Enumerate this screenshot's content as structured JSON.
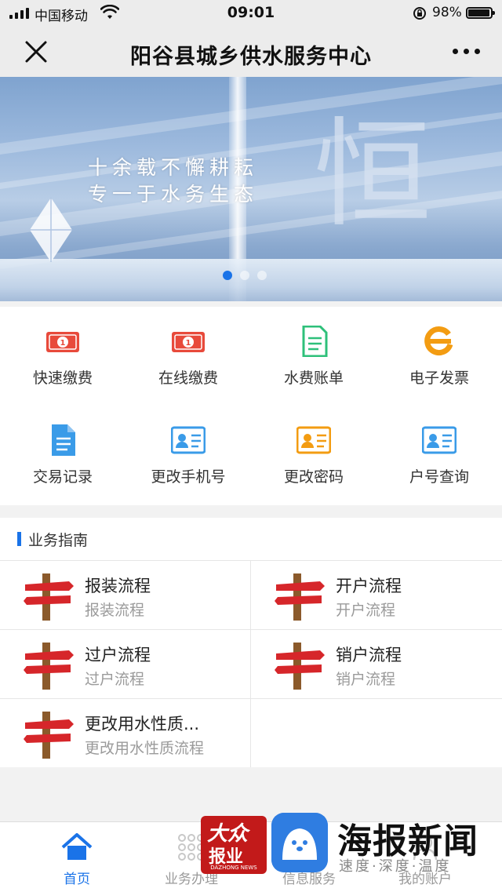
{
  "status_bar": {
    "carrier": "中国移动",
    "time": "09:01",
    "battery": "98%",
    "battery_level": 0.98
  },
  "nav": {
    "title": "阳谷县城乡供水服务中心"
  },
  "banner": {
    "line1": "十余载不懈耕耘",
    "line2": "专一于水务生态",
    "big_char": "恒",
    "slide_count": 3,
    "active_slide": 1
  },
  "services": [
    {
      "label": "快速缴费",
      "icon": "banknote-icon",
      "color": "#e84a3b"
    },
    {
      "label": "在线缴费",
      "icon": "banknote-icon",
      "color": "#e84a3b"
    },
    {
      "label": "水费账单",
      "icon": "document-icon",
      "color": "#2ec07a"
    },
    {
      "label": "电子发票",
      "icon": "browser-e-icon",
      "color": "#f39c12"
    },
    {
      "label": "交易记录",
      "icon": "file-icon",
      "color": "#3a9be8"
    },
    {
      "label": "更改手机号",
      "icon": "id-card-icon",
      "color": "#3a9be8"
    },
    {
      "label": "更改密码",
      "icon": "id-card-icon",
      "color": "#f39c12"
    },
    {
      "label": "户号查询",
      "icon": "id-card-icon",
      "color": "#3a9be8"
    }
  ],
  "guide": {
    "title": "业务指南",
    "items": [
      {
        "title": "报装流程",
        "subtitle": "报装流程"
      },
      {
        "title": "开户流程",
        "subtitle": "开户流程"
      },
      {
        "title": "过户流程",
        "subtitle": "过户流程"
      },
      {
        "title": "销户流程",
        "subtitle": "销户流程"
      },
      {
        "title": "更改用水性质...",
        "subtitle": "更改用水性质流程"
      }
    ]
  },
  "tabs": [
    {
      "label": "首页",
      "icon": "home-icon",
      "active": true
    },
    {
      "label": "业务办理",
      "icon": "dots-grid-icon",
      "active": false
    },
    {
      "label": "信息服务",
      "icon": "info-icon",
      "active": false
    },
    {
      "label": "我的账户",
      "icon": "user-icon",
      "active": false
    }
  ],
  "watermark": {
    "logo1_line1": "大众",
    "logo1_line2": "报业",
    "logo1_en": "DAZHONG NEWS",
    "brand": "海报新闻",
    "tagline": "速度·深度·温度"
  },
  "colors": {
    "accent": "#1a73e8",
    "red": "#e84a3b",
    "green": "#2ec07a",
    "orange": "#f39c12",
    "blue": "#3a9be8"
  }
}
